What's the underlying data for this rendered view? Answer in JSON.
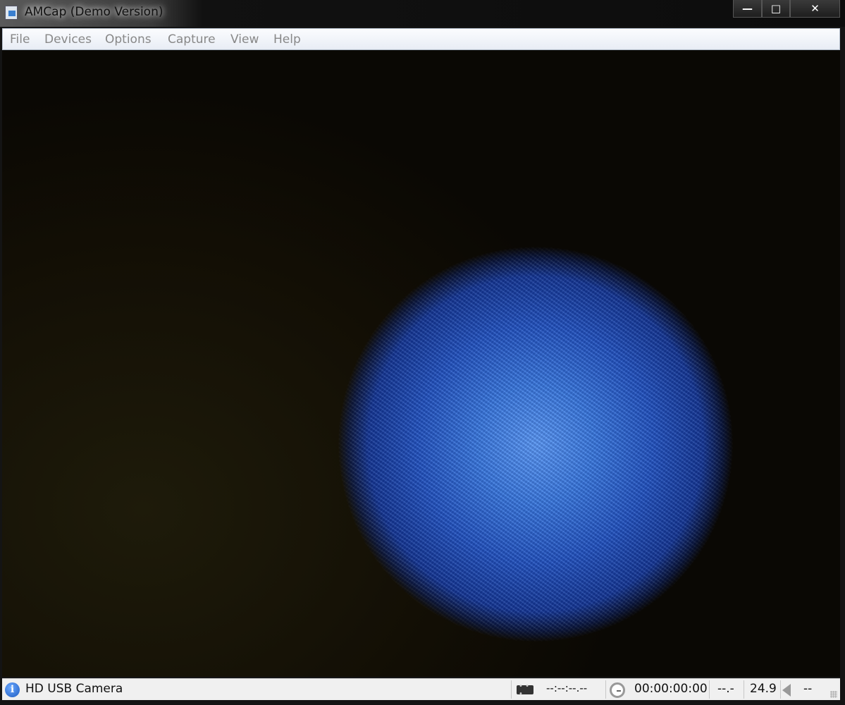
{
  "window": {
    "title": "AMCap (Demo Version)",
    "minimize": "—",
    "maximize": "□",
    "close": "✕"
  },
  "menu": [
    "File",
    "Devices",
    "Options",
    "Capture",
    "View",
    "Help"
  ],
  "status": {
    "device": "HD USB Camera",
    "timecode": "--:--:--.--",
    "capture_time": "00:00:00:00",
    "dropped": "--.-",
    "fps": "24.9",
    "audio": "--"
  }
}
